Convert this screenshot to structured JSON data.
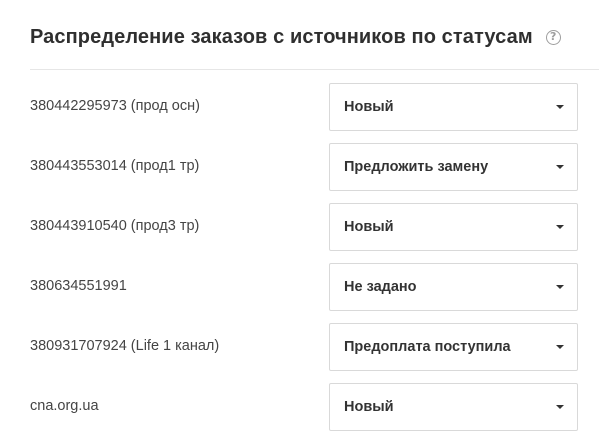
{
  "header": {
    "title": "Распределение заказов с источников по статусам",
    "help_glyph": "?"
  },
  "rows": [
    {
      "source": "380442295973 (прод осн)",
      "status": "Новый"
    },
    {
      "source": "380443553014 (прод1 тр)",
      "status": "Предложить замену"
    },
    {
      "source": "380443910540 (прод3 тр)",
      "status": "Новый"
    },
    {
      "source": "380634551991",
      "status": "Не задано"
    },
    {
      "source": "380931707924 (Life 1 канал)",
      "status": "Предоплата поступила"
    },
    {
      "source": "cna.org.ua",
      "status": "Новый"
    }
  ],
  "icons": {
    "help": "question-circle-icon",
    "select_caret": "caret-down-icon"
  },
  "colors": {
    "title": "#2f2f2f",
    "text": "#444444",
    "border": "#d9d9d9",
    "divider": "#e6e6e6",
    "help_icon": "#9e9e9e"
  }
}
